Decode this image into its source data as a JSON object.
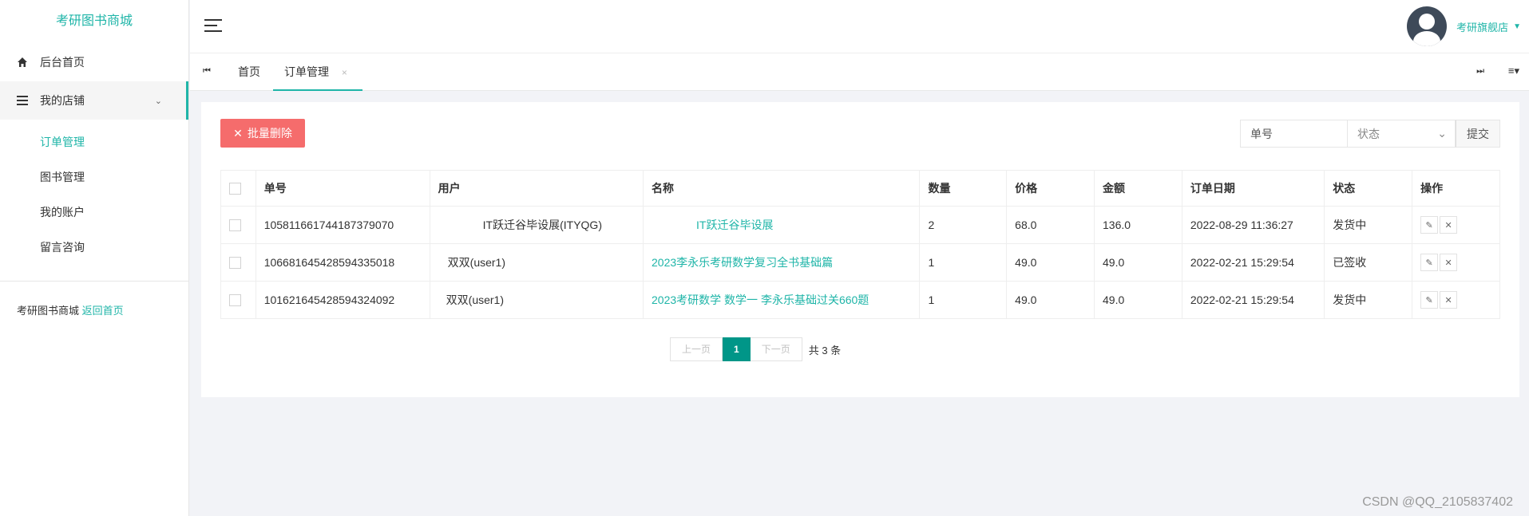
{
  "sidebar": {
    "brand": "考研图书商城",
    "items": [
      {
        "label": "后台首页",
        "icon": "home-icon"
      },
      {
        "label": "我的店铺",
        "icon": "menu-icon",
        "chevron": "⌄"
      }
    ],
    "subitems": [
      "订单管理",
      "图书管理",
      "我的账户",
      "留言咨询"
    ],
    "footer": {
      "text": "考研图书商城",
      "link": "返回首页"
    }
  },
  "header": {
    "user_name": "考研旗舰店",
    "caret": "▼"
  },
  "tabs": {
    "prev_icon": "⏮",
    "next_icon": "⏭",
    "menu_icon": "≡▾",
    "items": [
      {
        "label": "首页"
      },
      {
        "label": "订单管理",
        "close": "×"
      }
    ]
  },
  "toolbar": {
    "batch_delete_icon": "✕",
    "batch_delete": "批量删除",
    "order_no_placeholder": "单号",
    "status_placeholder": "状态",
    "status_caret": "⌄",
    "submit": "提交"
  },
  "table": {
    "headers": [
      "单号",
      "用户",
      "名称",
      "数量",
      "价格",
      "金额",
      "订单日期",
      "状态",
      "操作"
    ],
    "rows": [
      {
        "order_no": "105811661744187379070",
        "user": "IT跃迁谷毕设展(ITYQG)",
        "name": "IT跃迁谷毕设展",
        "qty": "2",
        "price": "68.0",
        "amount": "136.0",
        "date": "2022-08-29 11:36:27",
        "status": "发货中"
      },
      {
        "order_no": "106681645428594335018",
        "user": "双双(user1)",
        "name": "2023李永乐考研数学复习全书基础篇",
        "qty": "1",
        "price": "49.0",
        "amount": "49.0",
        "date": "2022-02-21 15:29:54",
        "status": "已签收"
      },
      {
        "order_no": "101621645428594324092",
        "user": "双双(user1)",
        "name": "2023考研数学 数学一 李永乐基础过关660题",
        "qty": "1",
        "price": "49.0",
        "amount": "49.0",
        "date": "2022-02-21 15:29:54",
        "status": "发货中"
      }
    ],
    "edit_icon": "✎",
    "delete_icon": "✕"
  },
  "pager": {
    "prev": "上一页",
    "current": "1",
    "next": "下一页",
    "total": "共 3 条"
  },
  "watermark": "CSDN @QQ_2105837402",
  "colors": {
    "accent": "#1fb5a8",
    "danger": "#f56c6c",
    "pager_active": "#009688"
  }
}
